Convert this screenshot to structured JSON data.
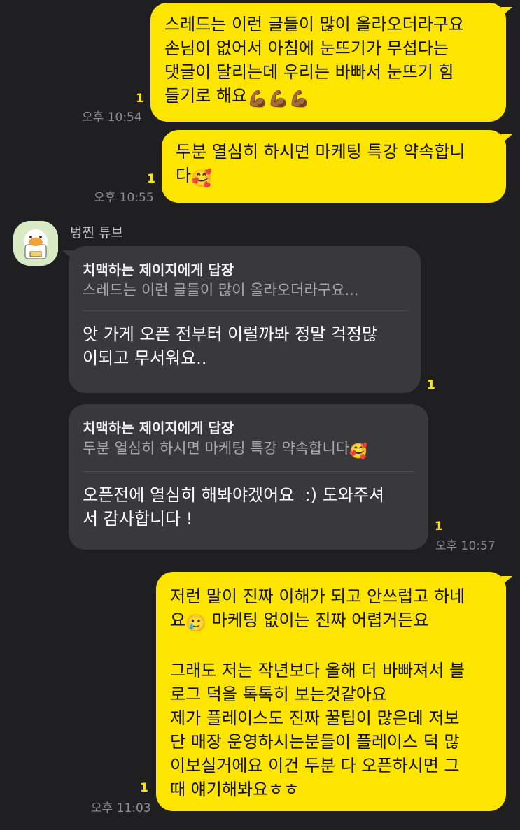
{
  "messages": [
    {
      "text": "스레드는 이런 글들이 많이 올라오더라구요\n손님이 없어서 아침에 눈뜨기가 무섭다는\n댓글이 달리는데 우리는 바빠서 눈뜨기 힘\n들기로 해요",
      "emoji": "💪🏾💪🏾💪🏾",
      "unread": "1",
      "time": "오후 10:54"
    },
    {
      "text": "두분 열심히 하시면 마케팅 특강 약속합니\n다",
      "emoji": "🥰",
      "unread": "1",
      "time": "오후 10:55"
    },
    {
      "sender": "벙찐 튜브",
      "reply_to": "치맥하는 제이지에게 답장",
      "quote": "스레드는 이런 글들이 많이 올라오더라구요...",
      "text": "앗 가게 오픈 전부터 이럴까봐 정말 걱정많\n이되고 무서워요..",
      "unread": "1"
    },
    {
      "reply_to": "치맥하는 제이지에게 답장",
      "quote": "두분 열심히 하시면 마케팅 특강 약속합니다",
      "quote_emoji": "🥰",
      "text": "오픈전에 열심히 해봐야겠어요  :) 도와주셔\n서 감사합니다 !",
      "unread": "1",
      "time": "오후 10:57"
    },
    {
      "line1": "저런 말이 진짜 이해가 되고 안쓰럽고 하네",
      "line2_pre": "요",
      "line2_emoji": "🥲",
      "line2_post": " 마케팅 없이는 진짜 어렵거든요",
      "rest": "\n그래도 저는 작년보다 올해 더 바빠져서 블\n로그 덕을 톡톡히 보는것같아요\n제가 플레이스도 진짜 꿀팁이 많은데 저보\n단 매장 운영하시는분들이 플레이스 덕 많\n이보실거에요 이건 두분 다 오픈하시면 그\n때 얘기해봐요ㅎㅎ",
      "unread": "1",
      "time": "오후 11:03"
    }
  ],
  "colors": {
    "background": "#1f1f21",
    "my_bubble": "#fee500",
    "other_bubble": "#39393b",
    "unread": "#fee500",
    "time": "#8e8e93"
  }
}
